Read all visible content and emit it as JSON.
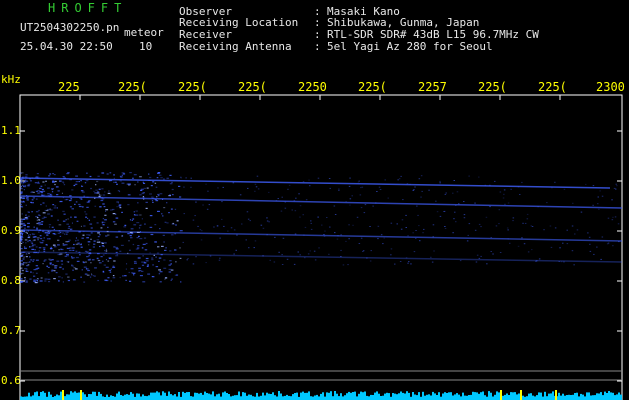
{
  "header": {
    "logo": "HROFFT",
    "filename": "UT2504302250.pn",
    "mode": "meteor",
    "datetime": "25.04.30 22:50",
    "count": "10"
  },
  "info": {
    "labels": [
      "Observer",
      "Receiving Location",
      "Receiver",
      "Receiving Antenna"
    ],
    "separators": [
      ":",
      ":",
      ":",
      ":"
    ],
    "values": [
      "Masaki Kano",
      "Shibukawa, Gunma, Japan",
      "RTL-SDR SDR# 43dB L15 96.7MHz CW",
      "5el Yagi Az 280 for Seoul"
    ]
  },
  "axes": {
    "y_unit": "kHz",
    "y_ticks": [
      "1.1",
      "1.0",
      "0.9",
      "0.8",
      "0.7",
      "0.6"
    ],
    "x_ticks": [
      "225",
      "225(",
      "225(",
      "225(",
      "2250",
      "225(",
      "2257",
      "225(",
      "225(",
      "2300"
    ]
  },
  "colors": {
    "background": "#000000",
    "text": "#e8e8e8",
    "accent": "#ffff00",
    "logo": "#33cc33",
    "signal": "#4060ff",
    "level_bar": "#00c8ff"
  }
}
